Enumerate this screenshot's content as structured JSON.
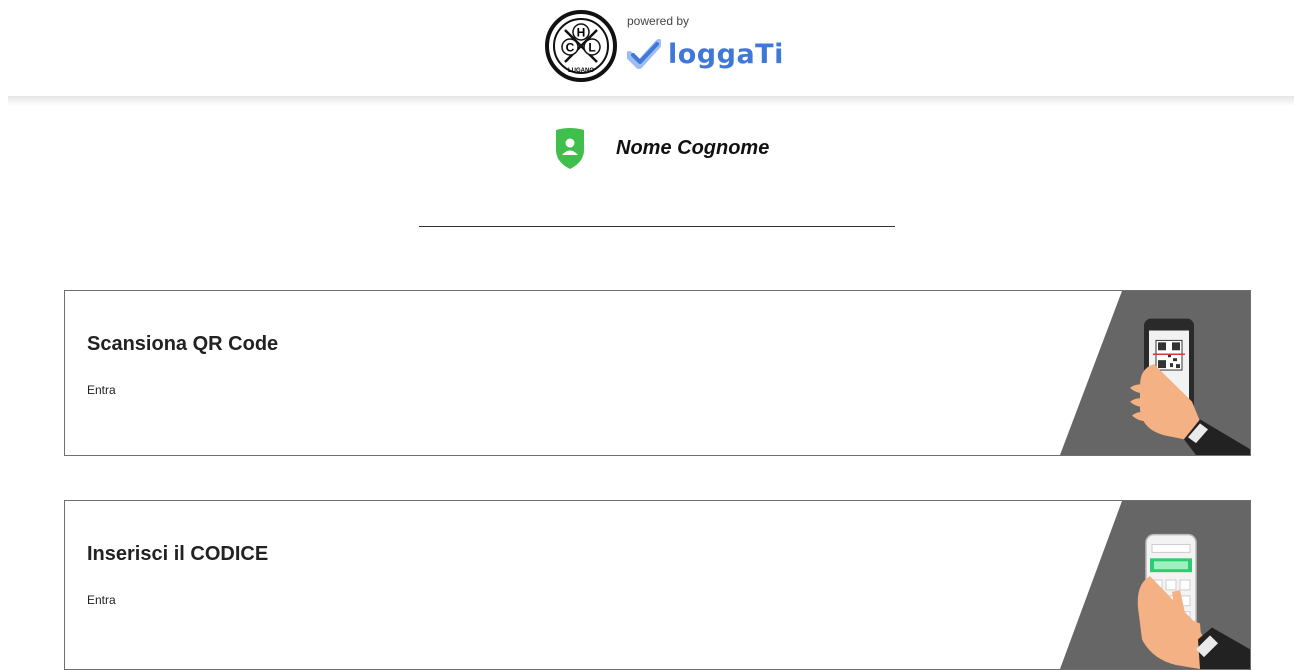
{
  "header": {
    "club_logo": {
      "letters": [
        "H",
        "C",
        "L"
      ],
      "ring_text": "LUGANO"
    },
    "powered_by": "powered by",
    "brand_name": "loggaTi",
    "brand_color": "#3f78d6"
  },
  "user": {
    "name": "Nome Cognome",
    "icon": "user-shield-icon",
    "icon_color": "#3fbf4b"
  },
  "cards": [
    {
      "title": "Scansiona QR Code",
      "subtitle": "Entra",
      "illustration": "phone-qr-scan-icon"
    },
    {
      "title": "Inserisci il CODICE",
      "subtitle": "Entra",
      "illustration": "phone-keypad-icon"
    }
  ],
  "colors": {
    "card_art_bg": "#666666",
    "divider": "#333333",
    "card_border": "#6f6f6f",
    "code_field": "#2ecc71"
  }
}
